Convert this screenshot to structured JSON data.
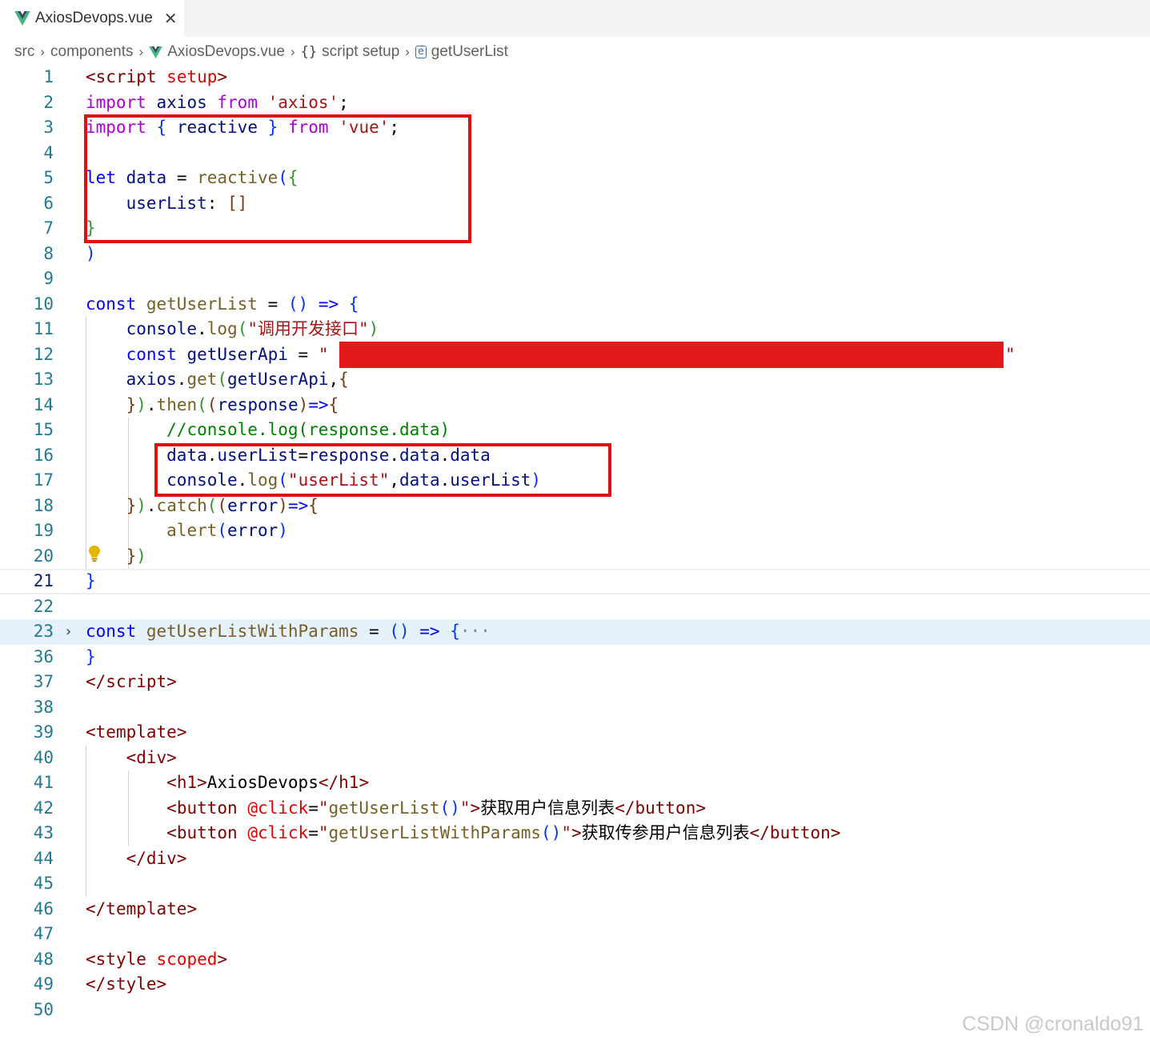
{
  "tab": {
    "label": "AxiosDevops.vue",
    "close": "✕",
    "icon": "vue-logo-icon"
  },
  "breadcrumb": {
    "items": [
      "src",
      "components",
      "AxiosDevops.vue",
      "script setup",
      "getUserList"
    ],
    "separator": "›"
  },
  "editor": {
    "line_numbers": [
      "1",
      "2",
      "3",
      "4",
      "5",
      "6",
      "7",
      "8",
      "9",
      "10",
      "11",
      "12",
      "13",
      "14",
      "15",
      "16",
      "17",
      "18",
      "19",
      "20",
      "21",
      "22",
      "23",
      "36",
      "37",
      "38",
      "39",
      "40",
      "41",
      "42",
      "43",
      "44",
      "45",
      "46",
      "47",
      "48",
      "49",
      "50"
    ],
    "active_line": "21",
    "fold_ellipsis": "···",
    "redacted_url_quote": "\"",
    "colors": {
      "keyword": "#af00db",
      "string": "#a31515",
      "declaration": "#0000ff",
      "function": "#795e26",
      "variable": "#001080",
      "comment": "#008000",
      "tag": "#800000",
      "annotation_box": "#e30e0e"
    }
  },
  "watermark": "CSDN @cronaldo91"
}
